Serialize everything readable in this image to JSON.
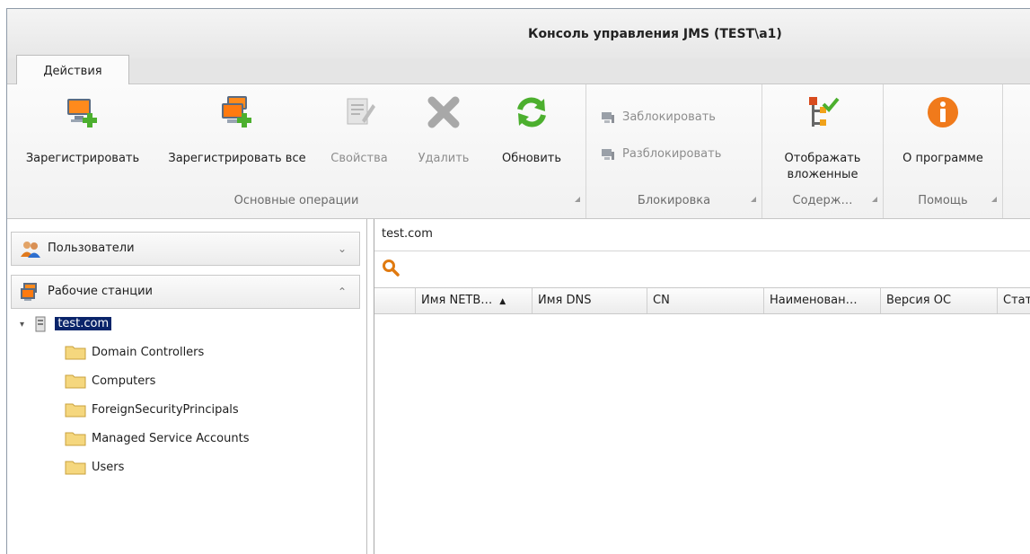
{
  "window": {
    "title": "Консоль управления JMS (TEST\\a1)"
  },
  "ribbon": {
    "tabs": [
      {
        "label": "Действия"
      }
    ],
    "groups": {
      "main_ops": {
        "label": "Основные операции",
        "buttons": [
          {
            "label": "Зарегистрировать",
            "icon": "register-workstation-icon",
            "enabled": true
          },
          {
            "label": "Зарегистрировать все",
            "icon": "register-all-icon",
            "enabled": true
          },
          {
            "label": "Свойства",
            "icon": "properties-icon",
            "enabled": false
          },
          {
            "label": "Удалить",
            "icon": "delete-icon",
            "enabled": false
          },
          {
            "label": "Обновить",
            "icon": "refresh-icon",
            "enabled": true
          }
        ]
      },
      "lock": {
        "label": "Блокировка",
        "buttons": [
          {
            "label": "Заблокировать",
            "icon": "lock-computer-icon",
            "enabled": false
          },
          {
            "label": "Разблокировать",
            "icon": "unlock-computer-icon",
            "enabled": false
          }
        ]
      },
      "content": {
        "label": "Содерж…",
        "buttons": [
          {
            "label": "Отображать вложенные",
            "icon": "show-nested-icon",
            "enabled": true
          }
        ]
      },
      "help": {
        "label": "Помощь",
        "buttons": [
          {
            "label": "О программе",
            "icon": "info-icon",
            "enabled": true
          }
        ]
      }
    }
  },
  "sidebar": {
    "sections": [
      {
        "label": "Пользователи",
        "icon": "users-icon",
        "expanded": false
      },
      {
        "label": "Рабочие станции",
        "icon": "workstations-icon",
        "expanded": true
      }
    ],
    "tree": {
      "root": {
        "label": "test.com",
        "selected": true
      },
      "children": [
        {
          "label": "Domain Controllers"
        },
        {
          "label": "Computers"
        },
        {
          "label": "ForeignSecurityPrincipals"
        },
        {
          "label": "Managed Service Accounts"
        },
        {
          "label": "Users"
        }
      ]
    }
  },
  "main": {
    "path": "test.com",
    "columns": [
      {
        "label": ""
      },
      {
        "label": "Имя NETB…",
        "sorted": "asc"
      },
      {
        "label": "Имя DNS"
      },
      {
        "label": "CN"
      },
      {
        "label": "Наименован…"
      },
      {
        "label": "Версия ОС"
      },
      {
        "label": "Стат"
      }
    ],
    "rows": []
  },
  "colors": {
    "selection": "#0a246a",
    "refresh_green": "#4caf2e",
    "info_orange": "#f07a1b",
    "folder_yellow": "#f5d77e"
  }
}
